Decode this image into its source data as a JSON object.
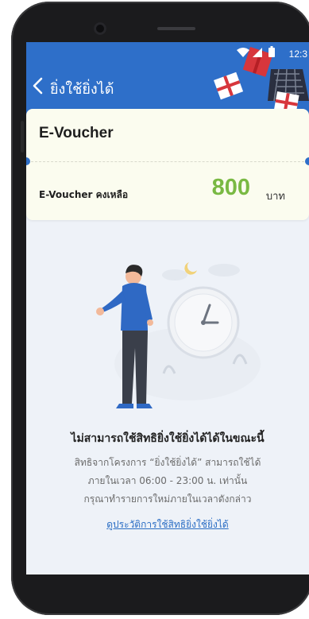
{
  "status_bar": {
    "time": "12:3"
  },
  "header": {
    "title": "ยิ่งใช้ยิ่งได้"
  },
  "voucher": {
    "title": "E-Voucher",
    "remaining_label": "E-Voucher คงเหลือ",
    "remaining_value": "800",
    "currency": "บาท"
  },
  "message": {
    "title": "ไม่สามารถใช้สิทธิยิ่งใช้ยิ่งได้ได้ในขณะนี้",
    "line1": "สิทธิจากโครงการ “ยิ่งใช้ยิ่งได้” สามารถใช้ได้",
    "line2": "ภายในเวลา 06:00 - 23:00 น. เท่านั้น",
    "line3": "กรุณาทำรายการใหม่ภายในเวลาดังกล่าว",
    "link": "ดูประวัติการใช้สิทธิยิ่งใช้ยิ่งได้"
  },
  "colors": {
    "header_blue": "#2e6fc9",
    "amount_green": "#79b943",
    "link_blue": "#2a6dc4",
    "card_bg": "#fbfcef"
  }
}
